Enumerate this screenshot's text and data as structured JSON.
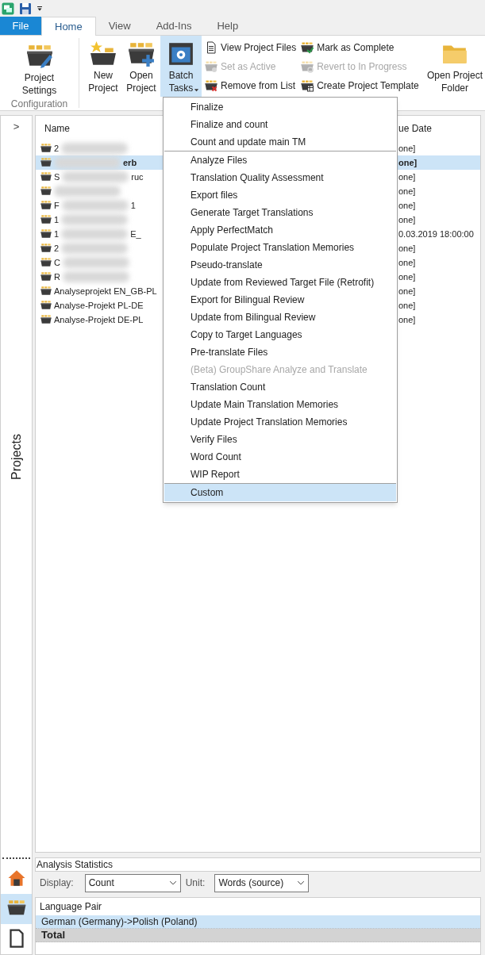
{
  "tabs": [
    {
      "label": "File",
      "kind": "file",
      "selected": false
    },
    {
      "label": "Home",
      "kind": "tab",
      "selected": true
    },
    {
      "label": "View",
      "kind": "tab",
      "selected": false
    },
    {
      "label": "Add-Ins",
      "kind": "tab",
      "selected": false
    },
    {
      "label": "Help",
      "kind": "tab",
      "selected": false
    }
  ],
  "ribbon": {
    "configuration": {
      "label": "Configuration",
      "button": {
        "label": "Project Settings",
        "kind": "settings"
      }
    },
    "large_buttons": [
      {
        "label": "New Project",
        "kind": "new",
        "pressed": false,
        "dropdown": false
      },
      {
        "label": "Open Project",
        "kind": "open",
        "pressed": false,
        "dropdown": false
      },
      {
        "label": "Batch Tasks",
        "kind": "batch",
        "pressed": true,
        "dropdown": true
      }
    ],
    "small_columns": [
      [
        {
          "label": "View Project Files",
          "kind": "files",
          "disabled": false
        },
        {
          "label": "Set as Active",
          "kind": "active",
          "disabled": true
        },
        {
          "label": "Remove from List",
          "kind": "remove",
          "disabled": false
        }
      ],
      [
        {
          "label": "Mark as Complete",
          "kind": "complete",
          "disabled": false
        },
        {
          "label": "Revert to In Progress",
          "kind": "revert",
          "disabled": true
        },
        {
          "label": "Create Project Template",
          "kind": "template",
          "disabled": false
        }
      ]
    ],
    "folder_button": {
      "label": "Open Project Folder"
    }
  },
  "sidebar": {
    "expand": ">",
    "title": "Projects",
    "nav": [
      {
        "kind": "home",
        "selected": false
      },
      {
        "kind": "projects",
        "selected": true
      },
      {
        "kind": "file",
        "selected": false
      }
    ]
  },
  "projects": {
    "columns": [
      "Name",
      "ue Date"
    ],
    "rows": [
      {
        "name_start": "2",
        "name_end": "",
        "redacted": true,
        "selected": false,
        "active": false,
        "due": "one]"
      },
      {
        "name_start": "",
        "name_end": "erb",
        "redacted": true,
        "selected": true,
        "active": true,
        "due": "one]"
      },
      {
        "name_start": "S",
        "name_end": "ruc",
        "redacted": true,
        "selected": false,
        "active": false,
        "due": "one]"
      },
      {
        "name_start": "",
        "name_end": "",
        "redacted": true,
        "selected": false,
        "active": false,
        "due": "one]"
      },
      {
        "name_start": "F",
        "name_end": "1",
        "redacted": true,
        "selected": false,
        "active": false,
        "due": "one]"
      },
      {
        "name_start": "1",
        "name_end": "",
        "redacted": true,
        "selected": false,
        "active": false,
        "due": "one]"
      },
      {
        "name_start": "1",
        "name_end": "E_",
        "redacted": true,
        "selected": false,
        "active": false,
        "due": "0.03.2019 18:00:00"
      },
      {
        "name_start": "2",
        "name_end": "",
        "redacted": true,
        "selected": false,
        "active": false,
        "due": "one]"
      },
      {
        "name_start": "C",
        "name_end": "",
        "redacted": true,
        "selected": false,
        "active": false,
        "due": "one]"
      },
      {
        "name_start": "R",
        "name_end": "",
        "redacted": true,
        "selected": false,
        "active": false,
        "due": "one]"
      },
      {
        "name_start": "Analyseprojekt EN_GB-PL",
        "name_end": "",
        "redacted": false,
        "selected": false,
        "active": false,
        "due": "one]"
      },
      {
        "name_start": "Analyse-Projekt PL-DE",
        "name_end": "",
        "redacted": false,
        "selected": false,
        "active": false,
        "due": "one]"
      },
      {
        "name_start": "Analyse-Projekt DE-PL",
        "name_end": "",
        "redacted": false,
        "selected": false,
        "active": false,
        "due": "one]"
      }
    ]
  },
  "batch_menu": [
    [
      {
        "label": "Finalize",
        "disabled": false,
        "selected": false
      },
      {
        "label": "Finalize and count",
        "disabled": false,
        "selected": false
      },
      {
        "label": "Count and update main TM",
        "disabled": false,
        "selected": false
      }
    ],
    [
      {
        "label": "Analyze Files",
        "disabled": false,
        "selected": false
      },
      {
        "label": "Translation Quality Assessment",
        "disabled": false,
        "selected": false
      },
      {
        "label": "Export files",
        "disabled": false,
        "selected": false
      },
      {
        "label": "Generate Target Translations",
        "disabled": false,
        "selected": false
      },
      {
        "label": "Apply PerfectMatch",
        "disabled": false,
        "selected": false
      },
      {
        "label": "Populate Project Translation Memories",
        "disabled": false,
        "selected": false
      },
      {
        "label": "Pseudo-translate",
        "disabled": false,
        "selected": false
      },
      {
        "label": "Update from Reviewed Target File (Retrofit)",
        "disabled": false,
        "selected": false
      },
      {
        "label": "Export for Bilingual Review",
        "disabled": false,
        "selected": false
      },
      {
        "label": "Update from Bilingual Review",
        "disabled": false,
        "selected": false
      },
      {
        "label": "Copy to Target Languages",
        "disabled": false,
        "selected": false
      },
      {
        "label": "Pre-translate Files",
        "disabled": false,
        "selected": false
      },
      {
        "label": "(Beta) GroupShare Analyze and Translate",
        "disabled": true,
        "selected": false
      },
      {
        "label": "Translation Count",
        "disabled": false,
        "selected": false
      },
      {
        "label": "Update Main Translation Memories",
        "disabled": false,
        "selected": false
      },
      {
        "label": "Update Project Translation Memories",
        "disabled": false,
        "selected": false
      },
      {
        "label": "Verify Files",
        "disabled": false,
        "selected": false
      },
      {
        "label": "Word Count",
        "disabled": false,
        "selected": false
      },
      {
        "label": "WIP Report",
        "disabled": false,
        "selected": false
      }
    ],
    [
      {
        "label": "Custom",
        "disabled": false,
        "selected": true
      }
    ]
  ],
  "analysis": {
    "title": "Analysis Statistics",
    "display_label": "Display:",
    "display_value": "Count",
    "unit_label": "Unit:",
    "unit_value": "Words (source)",
    "column": "Language Pair",
    "rows": [
      {
        "label": "German (Germany)->Polish (Poland)",
        "kind": "pair",
        "selected": true
      },
      {
        "label": "Total",
        "kind": "total",
        "selected": false
      }
    ]
  }
}
